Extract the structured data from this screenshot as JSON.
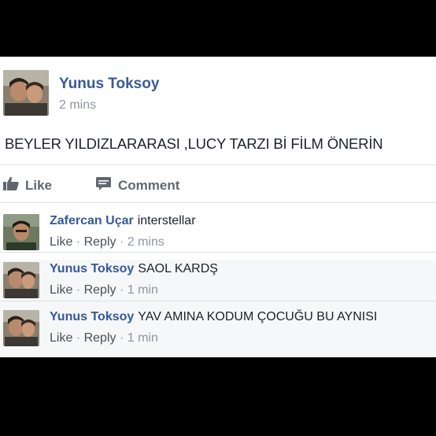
{
  "post": {
    "author": "Yunus Toksoy",
    "time": "2 mins",
    "text": "BEYLER YILDIZLARARASI ,LUCY TARZI Bİ FİLM ÖNERİN"
  },
  "actions": {
    "like": "Like",
    "comment": "Comment"
  },
  "comments": [
    {
      "author": "Zafercan Uçar",
      "text": "interstellar",
      "like": "Like",
      "reply": "Reply",
      "time": "2 mins"
    },
    {
      "author": "Yunus Toksoy",
      "text": "SAOL KARDŞ",
      "like": "Like",
      "reply": "Reply",
      "time": "1 min"
    },
    {
      "author": "Yunus Toksoy",
      "text": "YAV AMINA KODUM ÇOCUĞU BU AYNISI",
      "like": "Like",
      "reply": "Reply",
      "time": "1 min"
    }
  ],
  "separator": "·",
  "colors": {
    "link": "#3b5998",
    "meta": "#90949c",
    "background": "#f6f7f9"
  },
  "icons": [
    "thumbs-up-icon",
    "comment-icon"
  ]
}
